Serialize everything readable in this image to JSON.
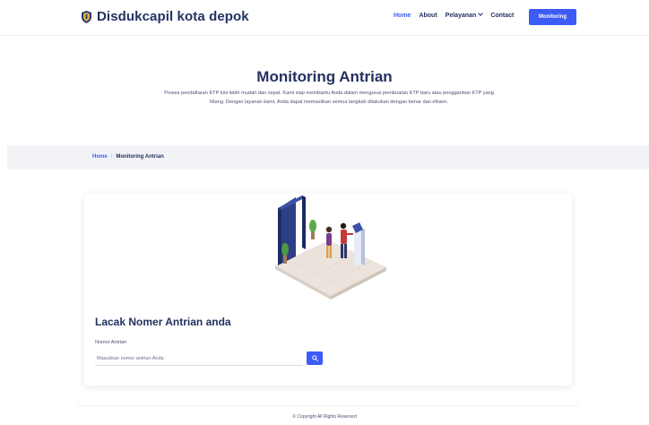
{
  "brand": {
    "name": "Disdukcapil kota depok",
    "logo_icon": "shield-crest-icon"
  },
  "nav": {
    "items": [
      {
        "label": "Home",
        "active": true
      },
      {
        "label": "About",
        "active": false
      },
      {
        "label": "Pelayanan",
        "active": false,
        "has_dropdown": true
      },
      {
        "label": "Contact",
        "active": false
      }
    ],
    "cta_label": "Monitoring"
  },
  "hero": {
    "title": "Monitoring Antrian",
    "description": "Proses pendaftaran KTP kini lebih mudah dan cepat. Kami siap membantu Anda dalam mengurus pembuatan KTP baru atau penggantian KTP yang hilang. Dengan layanan kami, Anda dapat memastikan semua langkah dilakukan dengan benar dan efisien."
  },
  "breadcrumb": {
    "home": "Home",
    "separator": "/",
    "current": "Monitoring Antrian"
  },
  "tracker": {
    "illustration_icon": "queue-kiosk-illustration",
    "title": "Lacak Nomer Antrian anda",
    "field_label": "Nomor Antrian",
    "placeholder": "Masukkan nomor antrian Anda",
    "value": "",
    "search_icon": "search-icon"
  },
  "footer": {
    "text": "© Copyright  All Rights Reserved"
  },
  "colors": {
    "accent": "#3d5bf6",
    "heading": "#233160",
    "breadcrumb_bg": "#f2f3f6"
  }
}
